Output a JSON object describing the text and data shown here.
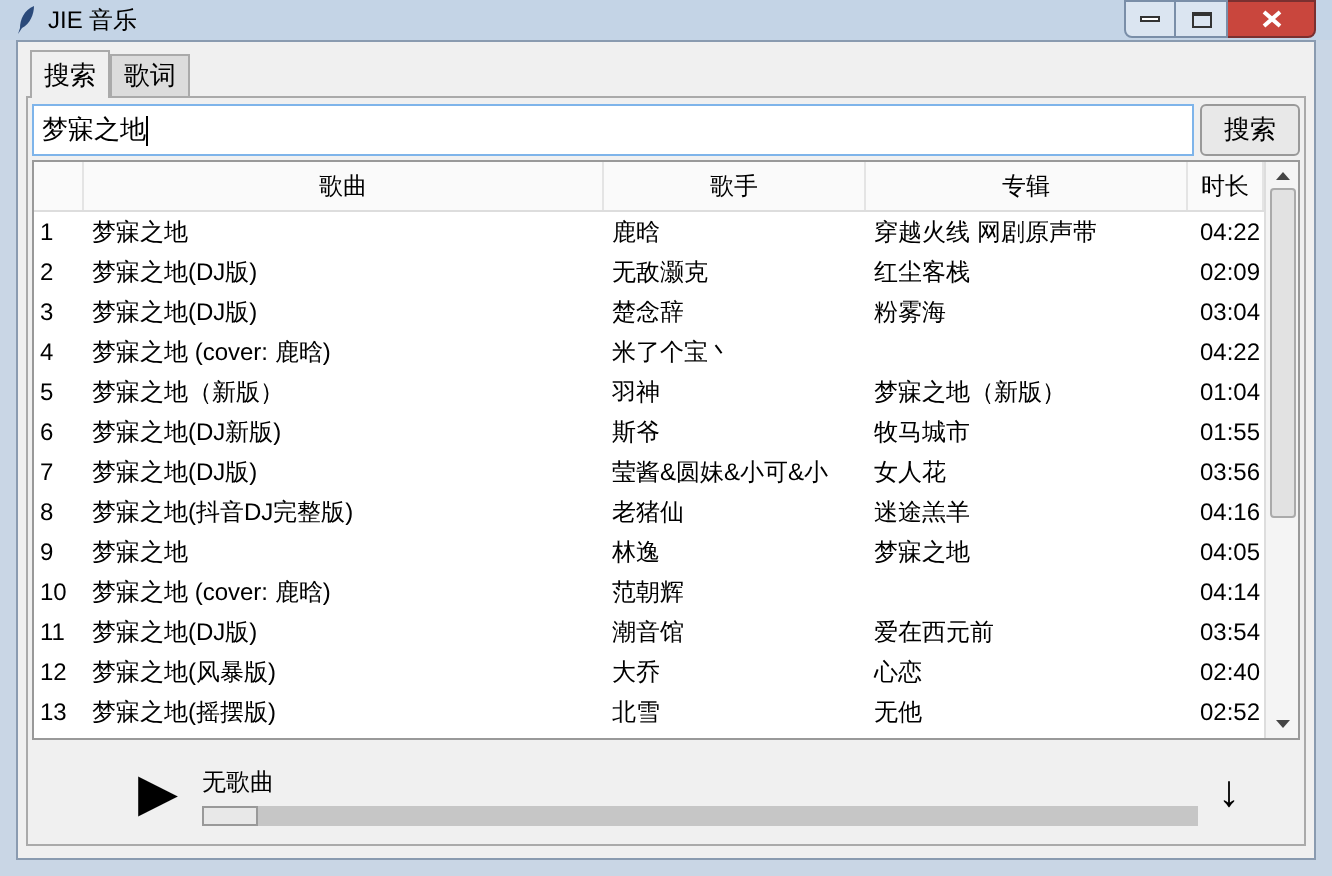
{
  "window": {
    "title": "JIE 音乐"
  },
  "tabs": [
    {
      "label": "搜索",
      "selected": true
    },
    {
      "label": "歌词",
      "selected": false
    }
  ],
  "search": {
    "value": "梦寐之地",
    "button": "搜索"
  },
  "table": {
    "columns": [
      "歌曲",
      "歌手",
      "专辑",
      "时长"
    ],
    "rows": [
      {
        "index": "1",
        "song": "梦寐之地",
        "artist": "鹿晗",
        "album": "穿越火线 网剧原声带",
        "duration": "04:22"
      },
      {
        "index": "2",
        "song": "梦寐之地(DJ版)",
        "artist": "无敌灏克",
        "album": "红尘客栈",
        "duration": "02:09"
      },
      {
        "index": "3",
        "song": "梦寐之地(DJ版)",
        "artist": "楚念辞",
        "album": "粉雾海",
        "duration": "03:04"
      },
      {
        "index": "4",
        "song": "梦寐之地 (cover: 鹿晗)",
        "artist": "米了个宝丶",
        "album": "",
        "duration": "04:22"
      },
      {
        "index": "5",
        "song": "梦寐之地（新版）",
        "artist": "羽神",
        "album": "梦寐之地（新版）",
        "duration": "01:04"
      },
      {
        "index": "6",
        "song": "梦寐之地(DJ新版)",
        "artist": "斯爷",
        "album": "牧马城市",
        "duration": "01:55"
      },
      {
        "index": "7",
        "song": "梦寐之地(DJ版)",
        "artist": "莹酱&圆妹&小可&小",
        "album": "女人花",
        "duration": "03:56"
      },
      {
        "index": "8",
        "song": "梦寐之地(抖音DJ完整版)",
        "artist": "老猪仙",
        "album": "迷途羔羊",
        "duration": "04:16"
      },
      {
        "index": "9",
        "song": "梦寐之地",
        "artist": "林逸",
        "album": "梦寐之地",
        "duration": "04:05"
      },
      {
        "index": "10",
        "song": "梦寐之地 (cover: 鹿晗)",
        "artist": "范朝辉",
        "album": "",
        "duration": "04:14"
      },
      {
        "index": "11",
        "song": "梦寐之地(DJ版)",
        "artist": "潮音馆",
        "album": "爱在西元前",
        "duration": "03:54"
      },
      {
        "index": "12",
        "song": "梦寐之地(风暴版)",
        "artist": "大乔",
        "album": "心恋",
        "duration": "02:40"
      },
      {
        "index": "13",
        "song": "梦寐之地(摇摆版)",
        "artist": "北雪",
        "album": "无他",
        "duration": "02:52"
      }
    ]
  },
  "player": {
    "play": "▶",
    "now_playing": "无歌曲",
    "progress": {
      "level": 0
    },
    "download": "↓"
  }
}
